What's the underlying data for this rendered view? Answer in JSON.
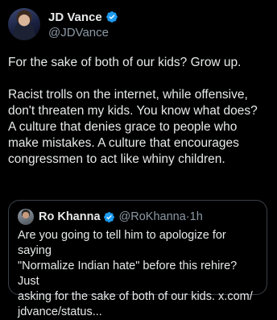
{
  "author": {
    "display_name": "JD Vance",
    "handle": "@JDVance",
    "verified": true,
    "avatar_icon": "profile-photo"
  },
  "tweet": {
    "paragraph1": "For the sake of both of our kids? Grow up.",
    "paragraph2_lines": [
      "Racist trolls on the internet, while offensive,",
      "don't threaten my kids. You know what does?",
      "A culture that denies grace to people who",
      "make mistakes. A culture that encourages",
      "congressmen to act like whiny children."
    ]
  },
  "quoted_tweet": {
    "display_name": "Ro Khanna",
    "handle": "@RoKhanna",
    "separator": "·",
    "time": "1h",
    "verified": true,
    "text_lines": [
      "Are you going to tell him to apologize for saying",
      "\"Normalize Indian hate\" before this rehire? Just",
      "asking for the sake of both of our kids. x.com/",
      "jdvance/status..."
    ]
  },
  "colors": {
    "background": "#000000",
    "text": "#e7e9ea",
    "secondary_text": "#8b98a5",
    "verified_badge": "#1d9bf0",
    "quote_border": "#3a4046"
  }
}
